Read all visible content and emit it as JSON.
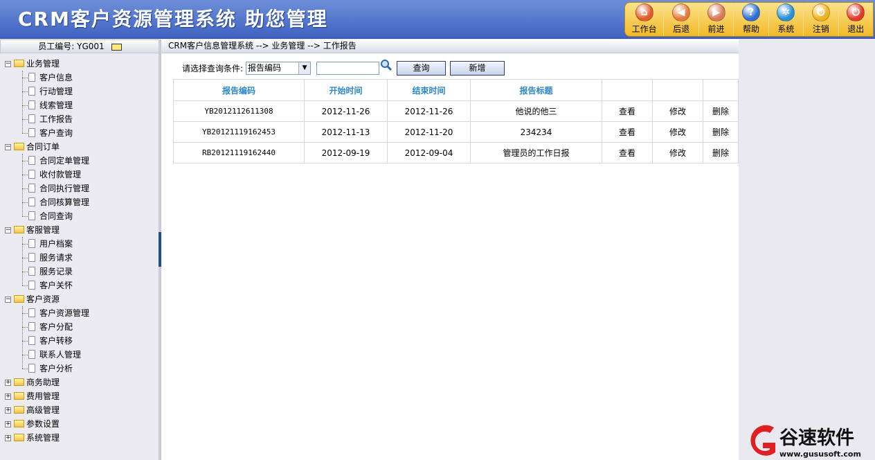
{
  "header": {
    "title": "CRM客户资源管理系统  助您管理"
  },
  "toolbar": [
    {
      "label": "工作台",
      "icon": "home-icon",
      "color": "#e25b2a"
    },
    {
      "label": "后退",
      "icon": "back-icon",
      "color": "#e57b3b"
    },
    {
      "label": "前进",
      "icon": "forward-icon",
      "color": "#d97a56"
    },
    {
      "label": "帮助",
      "icon": "help-icon",
      "color": "#2f6fd1"
    },
    {
      "label": "系统",
      "icon": "gear-icon",
      "color": "#2b8fd8"
    },
    {
      "label": "注销",
      "icon": "logout-icon",
      "color": "#f0b21a"
    },
    {
      "label": "退出",
      "icon": "power-icon",
      "color": "#e23a2a"
    }
  ],
  "sidebar": {
    "employee": "员工编号: YG001",
    "groups": [
      {
        "label": "业务管理",
        "expanded": true,
        "items": [
          "客户信息",
          "行动管理",
          "线索管理",
          "工作报告",
          "客户查询"
        ]
      },
      {
        "label": "合同订单",
        "expanded": true,
        "items": [
          "合同定单管理",
          "收付款管理",
          "合同执行管理",
          "合同核算管理",
          "合同查询"
        ]
      },
      {
        "label": "客服管理",
        "expanded": true,
        "items": [
          "用户档案",
          "服务请求",
          "服务记录",
          "客户关怀"
        ]
      },
      {
        "label": "客户资源",
        "expanded": true,
        "items": [
          "客户资源管理",
          "客户分配",
          "客户转移",
          "联系人管理",
          "客户分析"
        ]
      },
      {
        "label": "商务助理",
        "expanded": false,
        "items": []
      },
      {
        "label": "费用管理",
        "expanded": false,
        "items": []
      },
      {
        "label": "高级管理",
        "expanded": false,
        "items": []
      },
      {
        "label": "参数设置",
        "expanded": false,
        "items": []
      },
      {
        "label": "系统管理",
        "expanded": false,
        "items": []
      }
    ]
  },
  "breadcrumb": "CRM客户信息管理系统 --> 业务管理 --> 工作报告",
  "search": {
    "label": "请选择查询条件:",
    "selected": "报告编码",
    "input_value": "",
    "query_label": "查询",
    "add_label": "新增"
  },
  "table": {
    "headers": [
      "报告编码",
      "开始时间",
      "结束时间",
      "报告标题",
      "",
      "",
      ""
    ],
    "rows": [
      {
        "code": "YB2012112611308",
        "start": "2012-11-26",
        "end": "2012-11-26",
        "title": "他说的他三",
        "view": "查看",
        "edit": "修改",
        "del": "删除"
      },
      {
        "code": "YB20121119162453",
        "start": "2012-11-13",
        "end": "2012-11-20",
        "title": "234234",
        "view": "查看",
        "edit": "修改",
        "del": "删除"
      },
      {
        "code": "RB20121119162440",
        "start": "2012-09-19",
        "end": "2012-09-04",
        "title": "管理员的工作日报",
        "view": "查看",
        "edit": "修改",
        "del": "删除"
      }
    ]
  },
  "watermark": {
    "name": "谷速软件",
    "url": "www.gususoft.com"
  }
}
